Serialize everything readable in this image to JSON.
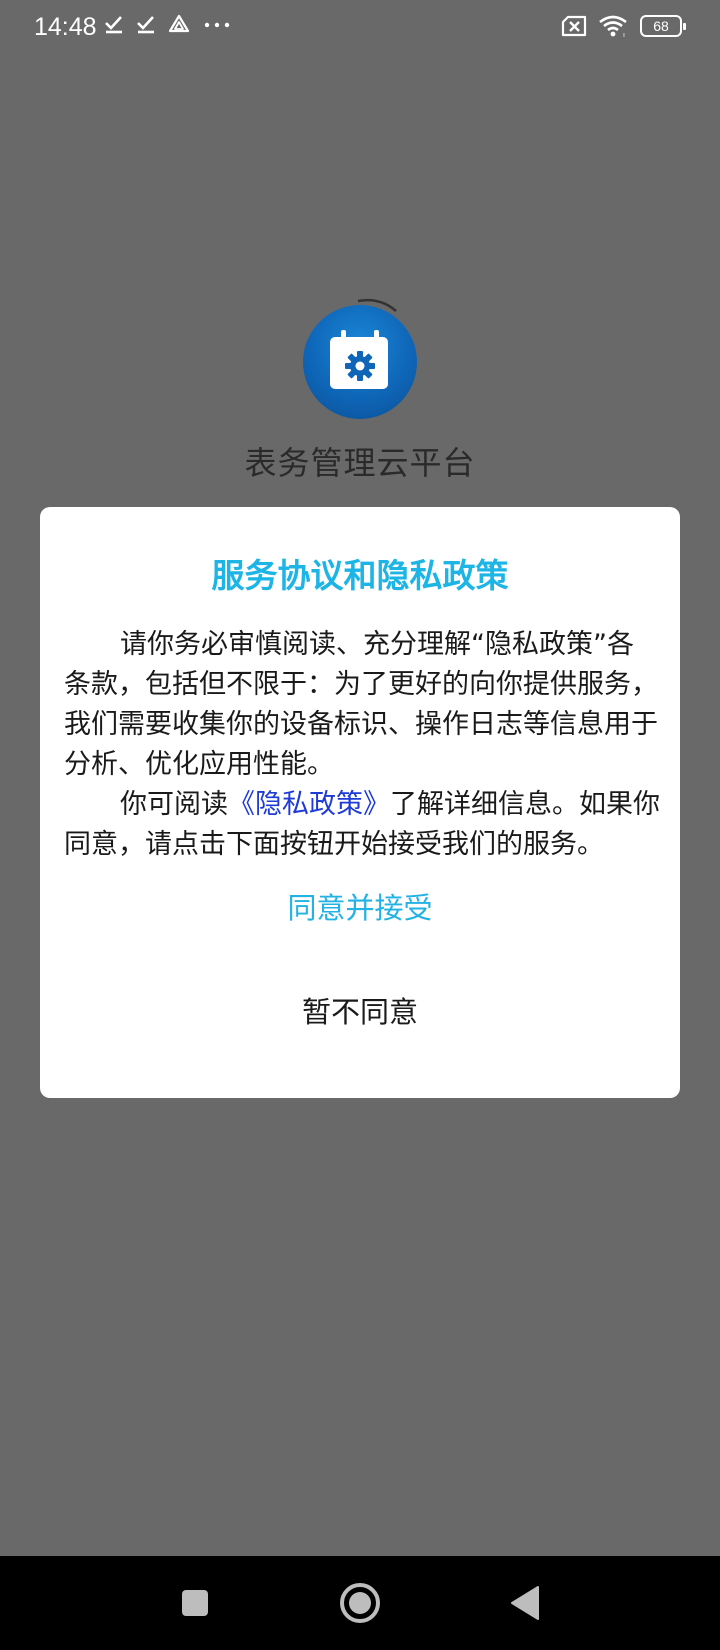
{
  "status_bar": {
    "time": "14:48",
    "battery_level": "68",
    "icons_left": [
      "check-download-icon",
      "check-download-icon",
      "triangle-app-icon",
      "more-dots-icon"
    ],
    "icons_right": [
      "sim-x-icon",
      "wifi-icon",
      "battery-icon"
    ]
  },
  "app": {
    "name": "表务管理云平台",
    "logo_icon": "calendar-gear-icon",
    "brand_color": "#0f66b8"
  },
  "dialog": {
    "title": "服务协议和隐私政策",
    "paragraph1": "请你务必审慎阅读、充分理解“隐私政策”各条款，包括但不限于：为了更好的向你提供服务，我们需要收集你的设备标识、操作日志等信息用于分析、优化应用性能。",
    "paragraph2_prefix": "你可阅读",
    "paragraph2_link": "《隐私政策》",
    "paragraph2_suffix": "了解详细信息。如果你同意，请点击下面按钮开始接受我们的服务。",
    "agree_label": "同意并接受",
    "disagree_label": "暂不同意",
    "title_color": "#1db4e6",
    "link_color": "#1f3bd6"
  },
  "nav_bar": {
    "buttons": [
      "recents-square-icon",
      "home-circle-icon",
      "back-triangle-icon"
    ]
  }
}
